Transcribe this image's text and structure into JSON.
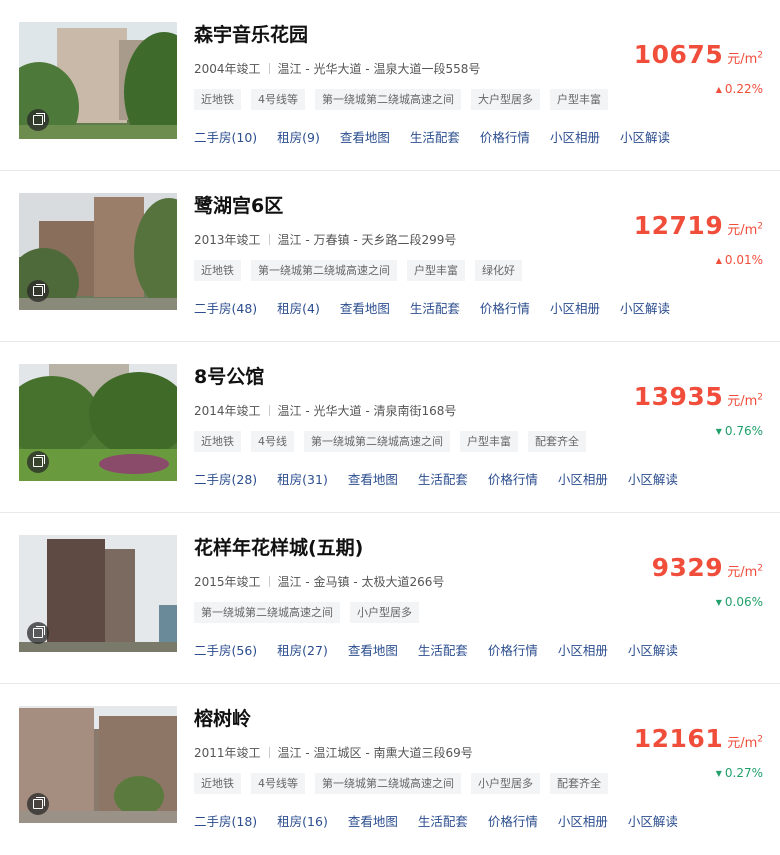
{
  "theme": {
    "price_color": "#f04d3b",
    "up_color": "#f04d3b",
    "down_color": "#22a06b",
    "link_color": "#2c4e8f"
  },
  "unit_label": "元/m",
  "unit_sup": "2",
  "listings": [
    {
      "title": "森宇音乐花园",
      "year": "2004年竣工",
      "location": "温江 - 光华大道 - 温泉大道一段558号",
      "tags": [
        "近地铁",
        "4号线等",
        "第一绕城第二绕城高速之间",
        "大户型居多",
        "户型丰富"
      ],
      "price": "10675",
      "change": "0.22%",
      "trend": "up",
      "trend_arrow": "▲",
      "links": [
        "二手房(10)",
        "租房(9)",
        "查看地图",
        "生活配套",
        "价格行情",
        "小区相册",
        "小区解读"
      ]
    },
    {
      "title": "鹭湖宫6区",
      "year": "2013年竣工",
      "location": "温江 - 万春镇 - 天乡路二段299号",
      "tags": [
        "近地铁",
        "第一绕城第二绕城高速之间",
        "户型丰富",
        "绿化好"
      ],
      "price": "12719",
      "change": "0.01%",
      "trend": "up",
      "trend_arrow": "▲",
      "links": [
        "二手房(48)",
        "租房(4)",
        "查看地图",
        "生活配套",
        "价格行情",
        "小区相册",
        "小区解读"
      ]
    },
    {
      "title": "8号公馆",
      "year": "2014年竣工",
      "location": "温江 - 光华大道 - 清泉南街168号",
      "tags": [
        "近地铁",
        "4号线",
        "第一绕城第二绕城高速之间",
        "户型丰富",
        "配套齐全"
      ],
      "price": "13935",
      "change": "0.76%",
      "trend": "down",
      "trend_arrow": "▼",
      "links": [
        "二手房(28)",
        "租房(31)",
        "查看地图",
        "生活配套",
        "价格行情",
        "小区相册",
        "小区解读"
      ]
    },
    {
      "title": "花样年花样城(五期)",
      "year": "2015年竣工",
      "location": "温江 - 金马镇 - 太极大道266号",
      "tags": [
        "第一绕城第二绕城高速之间",
        "小户型居多"
      ],
      "price": "9329",
      "change": "0.06%",
      "trend": "down",
      "trend_arrow": "▼",
      "links": [
        "二手房(56)",
        "租房(27)",
        "查看地图",
        "生活配套",
        "价格行情",
        "小区相册",
        "小区解读"
      ]
    },
    {
      "title": "榕树岭",
      "year": "2011年竣工",
      "location": "温江 - 温江城区 - 南熏大道三段69号",
      "tags": [
        "近地铁",
        "4号线等",
        "第一绕城第二绕城高速之间",
        "小户型居多",
        "配套齐全"
      ],
      "price": "12161",
      "change": "0.27%",
      "trend": "down",
      "trend_arrow": "▼",
      "links": [
        "二手房(18)",
        "租房(16)",
        "查看地图",
        "生活配套",
        "价格行情",
        "小区相册",
        "小区解读"
      ]
    }
  ]
}
